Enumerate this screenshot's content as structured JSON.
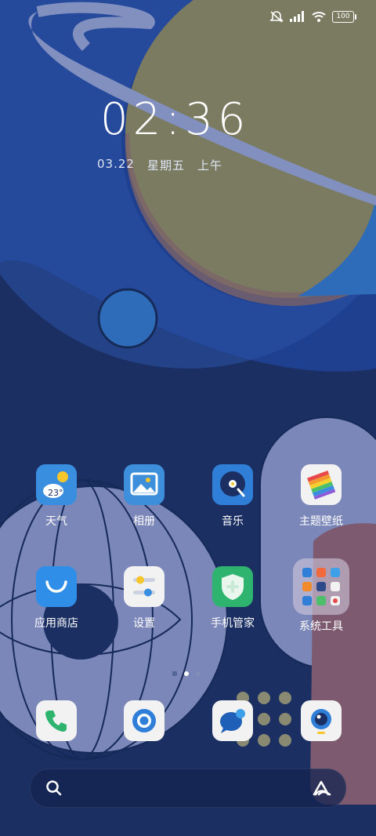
{
  "status_bar": {
    "icons": [
      "mute-icon",
      "signal-icon",
      "wifi-icon",
      "battery-icon"
    ],
    "battery": "100"
  },
  "lock_clock": {
    "time": "02:36",
    "date": "03.22",
    "weekday": "星期五",
    "period": "上午"
  },
  "apps_row1": [
    {
      "label": "天气",
      "icon": "weather-icon",
      "temp": "23°"
    },
    {
      "label": "相册",
      "icon": "gallery-icon"
    },
    {
      "label": "音乐",
      "icon": "music-icon"
    },
    {
      "label": "主题壁纸",
      "icon": "theme-icon"
    }
  ],
  "apps_row2": [
    {
      "label": "应用商店",
      "icon": "app-store-icon"
    },
    {
      "label": "设置",
      "icon": "settings-icon"
    },
    {
      "label": "手机管家",
      "icon": "phone-manager-icon"
    },
    {
      "label": "系统工具",
      "icon": "system-tools-folder-icon"
    }
  ],
  "dock": [
    "phone-icon",
    "browser-icon",
    "messages-icon",
    "camera-icon"
  ],
  "page_indicator": {
    "pages": 2,
    "active": 1
  },
  "colors": {
    "background": "#1b2f63",
    "planet": "#7a7b60",
    "ring": "#8290c0",
    "accent_blue": "#2e6bb8"
  }
}
